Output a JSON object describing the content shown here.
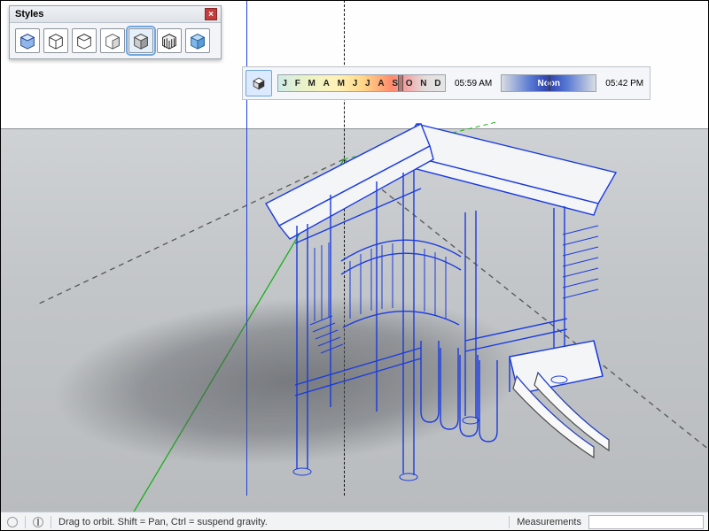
{
  "styles_panel": {
    "title": "Styles",
    "items": [
      {
        "name": "shaded-with-textures"
      },
      {
        "name": "wireframe"
      },
      {
        "name": "hidden-line"
      },
      {
        "name": "shaded"
      },
      {
        "name": "monochrome"
      },
      {
        "name": "sketchy"
      },
      {
        "name": "xray"
      }
    ],
    "selected_index": 4
  },
  "shadows_toolbar": {
    "months": [
      "J",
      "F",
      "M",
      "A",
      "M",
      "J",
      "J",
      "A",
      "S",
      "O",
      "N",
      "D"
    ],
    "time_start": "05:59 AM",
    "noon_label": "Noon",
    "time_end": "05:42 PM"
  },
  "statusbar": {
    "hint": "Drag to orbit. Shift = Pan, Ctrl = suspend gravity.",
    "measurements_label": "Measurements"
  }
}
